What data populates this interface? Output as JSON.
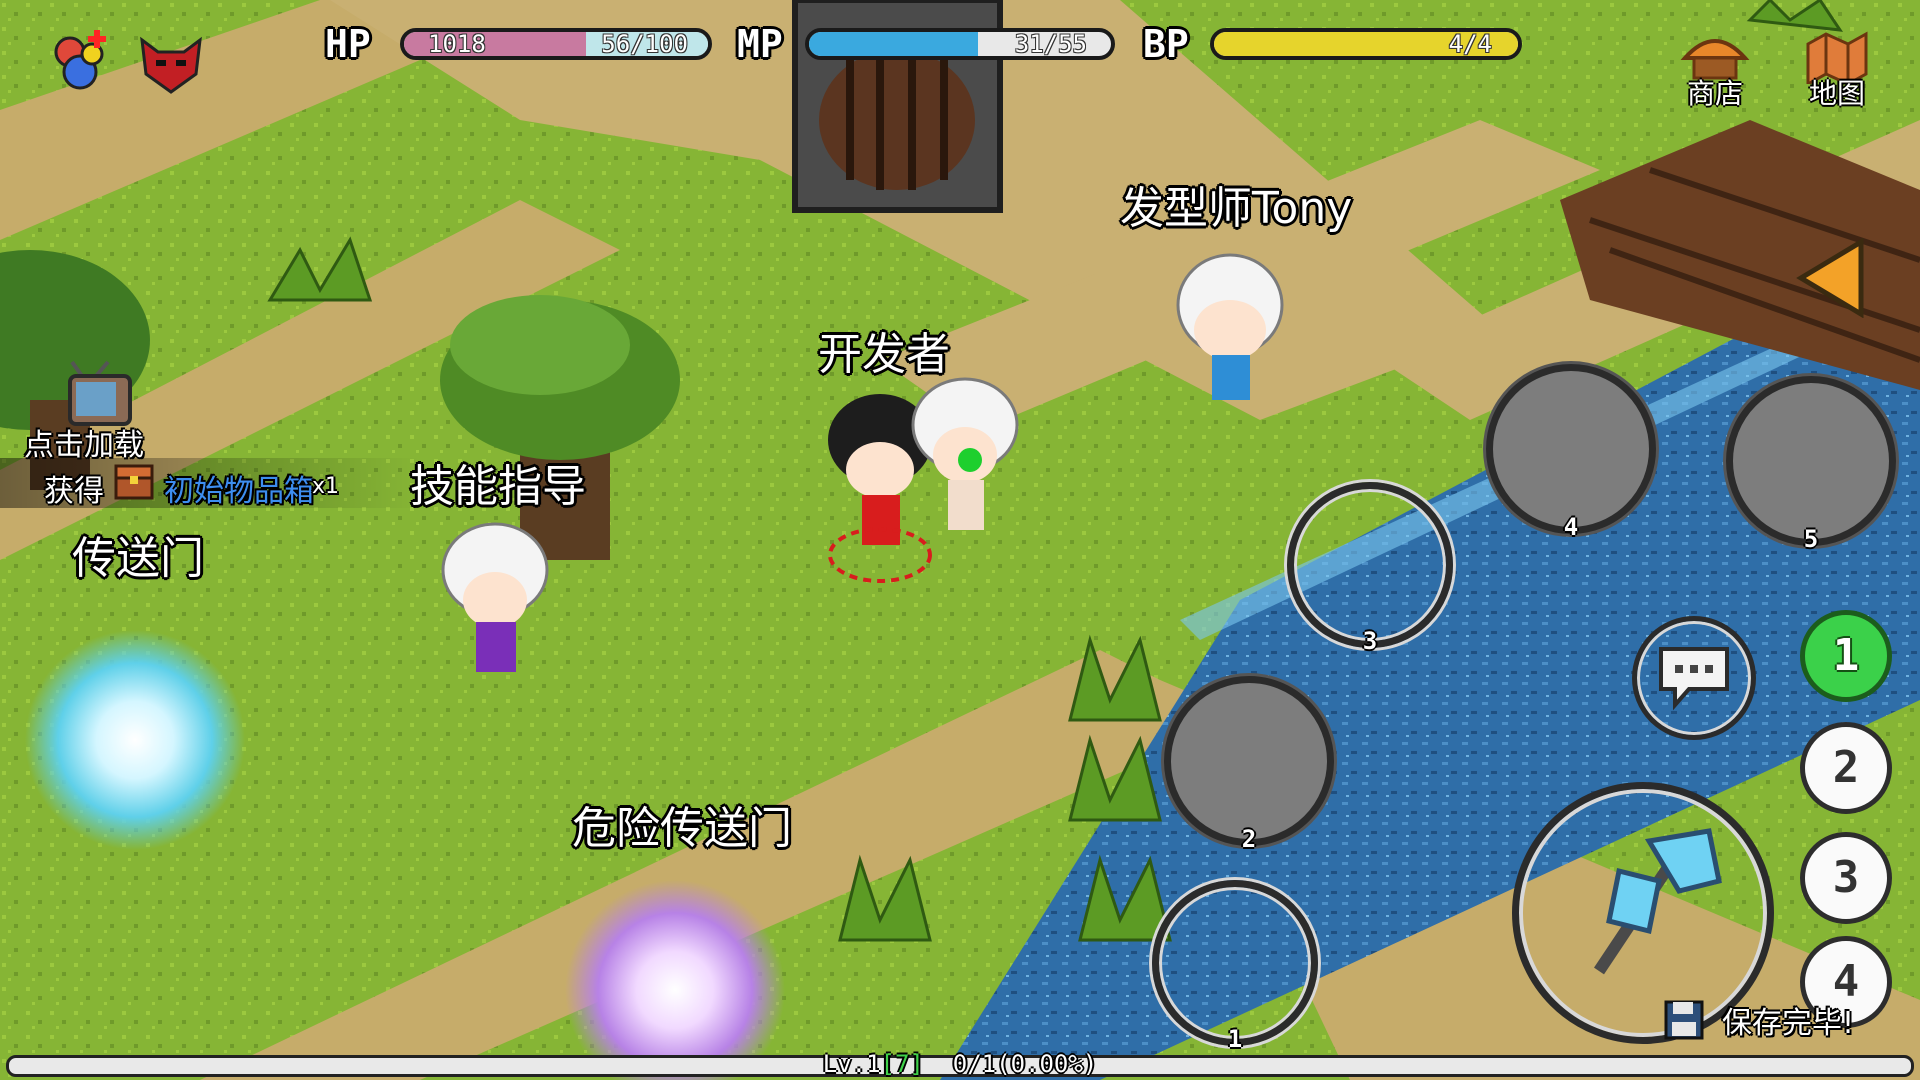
{
  "hud": {
    "hp": {
      "label": "HP",
      "value": "1018",
      "shield": "56/100",
      "fill_fraction": 0.6,
      "color": "#c87aa0"
    },
    "mp": {
      "label": "MP",
      "value": "31/55",
      "fill_fraction": 0.56,
      "color": "#3aa9df"
    },
    "bp": {
      "label": "BP",
      "value": "4/4",
      "fill_fraction": 1.0,
      "color": "#e6d42c"
    },
    "icons": [
      "potion-icon",
      "demon-mask-icon"
    ]
  },
  "top_buttons": {
    "shop": {
      "label": "商店",
      "icon": "shop-icon"
    },
    "map": {
      "label": "地图",
      "icon": "map-icon"
    }
  },
  "npcs": {
    "stylist": "发型师Tony",
    "developer": "开发者",
    "skill_guide": "技能指导",
    "teleport": "传送门",
    "danger_teleport": "危险传送门"
  },
  "load_tv": {
    "label": "点击加载",
    "icon": "tv-icon"
  },
  "loot_notice": {
    "prefix": "获得",
    "item": "初始物品箱",
    "count": "x1",
    "icon": "chest-icon"
  },
  "skills": [
    {
      "number": "1",
      "state": "empty"
    },
    {
      "number": "2",
      "state": "filled"
    },
    {
      "number": "3",
      "state": "empty"
    },
    {
      "number": "4",
      "state": "filled"
    },
    {
      "number": "5",
      "state": "filled"
    }
  ],
  "hotbar_slots": [
    {
      "label": "1",
      "active": true
    },
    {
      "label": "2",
      "active": false
    },
    {
      "label": "3",
      "active": false
    },
    {
      "label": "4",
      "active": false
    }
  ],
  "chat_button": {
    "icon": "chat-bubble-icon"
  },
  "attack_button": {
    "icon": "axe-icon"
  },
  "collapse_button": {
    "icon": "triangle-left-icon"
  },
  "save_notice": {
    "text": "保存完毕!",
    "icon": "floppy-disk-icon"
  },
  "status": {
    "level": "Lv.1",
    "level_box": "[7]",
    "exp": "0/1(0.00%)",
    "exp_fraction": 0.0
  }
}
